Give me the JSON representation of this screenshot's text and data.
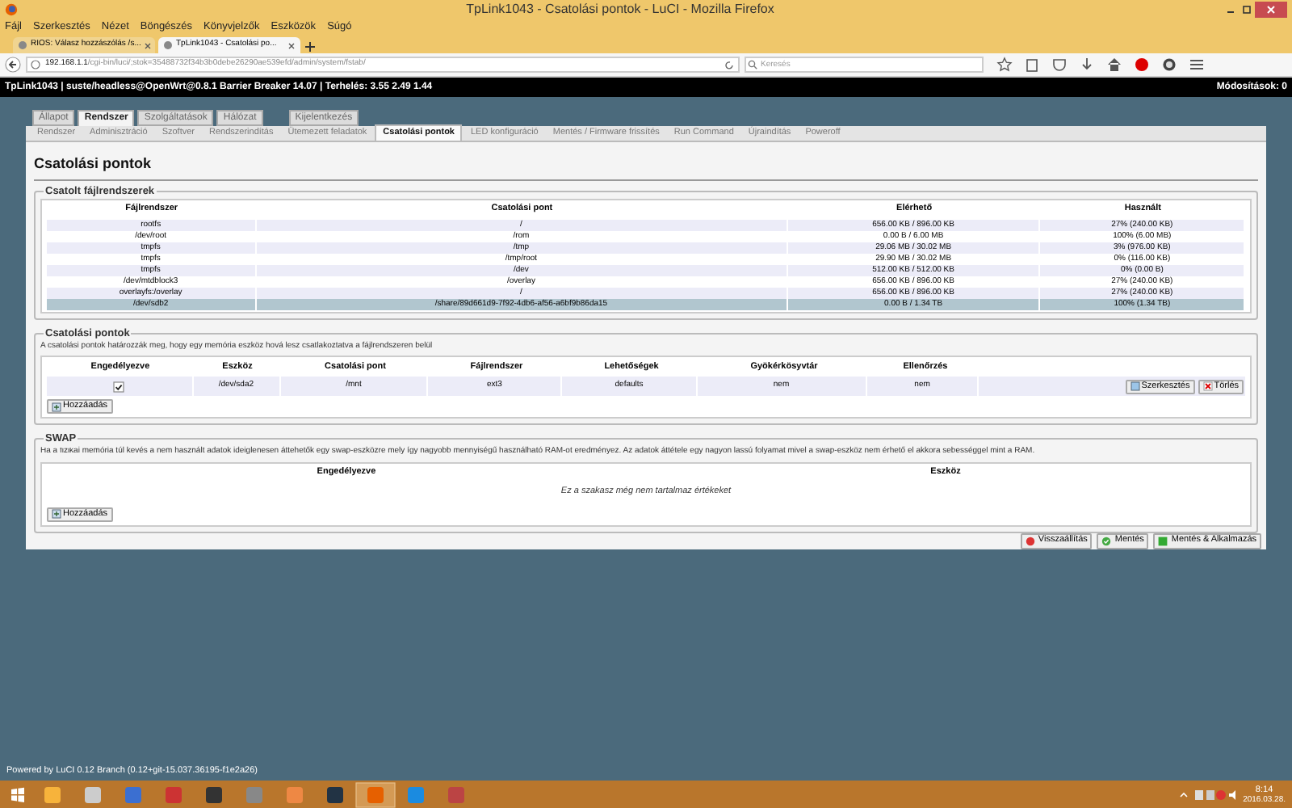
{
  "window": {
    "title": "TpLink1043 - Csatolási pontok - LuCI - Mozilla Firefox"
  },
  "menu": [
    "Fájl",
    "Szerkesztés",
    "Nézet",
    "Böngészés",
    "Könyvjelzők",
    "Eszközök",
    "Súgó"
  ],
  "browser_tabs": [
    {
      "label": "RIOS: Válasz hozzászólás /s...",
      "selected": false
    },
    {
      "label": "TpLink1043 - Csatolási po...",
      "selected": true
    }
  ],
  "address": {
    "host": "192.168.1.1",
    "path": "/cgi-bin/luci/;stok=35488732f34b3b0debe26290ae539efd/admin/system/fstab/"
  },
  "search": {
    "placeholder": "Keresés"
  },
  "status_bar": {
    "host_info": "TpLink1043 | suste/headless@OpenWrt@0.8.1 Barrier Breaker 14.07 | Terhelés: 3.55 2.49 1.44",
    "changes": "Módosítások: 0"
  },
  "main_tabs": [
    {
      "label": "Állapot",
      "selected": false
    },
    {
      "label": "Rendszer",
      "selected": true
    },
    {
      "label": "Szolgáltatások",
      "selected": false
    },
    {
      "label": "Hálózat",
      "selected": false
    },
    {
      "label": "Kijelentkezés",
      "selected": false
    }
  ],
  "sub_tabs": [
    {
      "label": "Rendszer",
      "selected": false
    },
    {
      "label": "Adminisztráció",
      "selected": false
    },
    {
      "label": "Szoftver",
      "selected": false
    },
    {
      "label": "Rendszerindítás",
      "selected": false
    },
    {
      "label": "Ütemezett feladatok",
      "selected": false
    },
    {
      "label": "Csatolási pontok",
      "selected": true
    },
    {
      "label": "LED konfiguráció",
      "selected": false
    },
    {
      "label": "Mentés / Firmware frissítés",
      "selected": false
    },
    {
      "label": "Run Command",
      "selected": false
    },
    {
      "label": "Újraindítás",
      "selected": false
    },
    {
      "label": "Poweroff",
      "selected": false
    }
  ],
  "page_title": "Csatolási pontok",
  "mounted": {
    "legend": "Csatolt fájlrendszerek",
    "columns": [
      "Fájlrendszer",
      "Csatolási pont",
      "Elérhető",
      "Használt"
    ],
    "rows": [
      {
        "cells": [
          "rootfs",
          "/",
          "656.00 KB / 896.00 KB",
          "27% (240.00 KB)"
        ],
        "highlighted": false
      },
      {
        "cells": [
          "/dev/root",
          "/rom",
          "0.00 B / 6.00 MB",
          "100% (6.00 MB)"
        ],
        "highlighted": false
      },
      {
        "cells": [
          "tmpfs",
          "/tmp",
          "29.06 MB / 30.02 MB",
          "3% (976.00 KB)"
        ],
        "highlighted": false
      },
      {
        "cells": [
          "tmpfs",
          "/tmp/root",
          "29.90 MB / 30.02 MB",
          "0% (116.00 KB)"
        ],
        "highlighted": false
      },
      {
        "cells": [
          "tmpfs",
          "/dev",
          "512.00 KB / 512.00 KB",
          "0% (0.00 B)"
        ],
        "highlighted": false
      },
      {
        "cells": [
          "/dev/mtdblock3",
          "/overlay",
          "656.00 KB / 896.00 KB",
          "27% (240.00 KB)"
        ],
        "highlighted": false
      },
      {
        "cells": [
          "overlayfs:/overlay",
          "/",
          "656.00 KB / 896.00 KB",
          "27% (240.00 KB)"
        ],
        "highlighted": false
      },
      {
        "cells": [
          "/dev/sdb2",
          "/share/89d661d9-7f92-4db6-af56-a6bf9b86da15",
          "0.00 B / 1.34 TB",
          "100% (1.34 TB)"
        ],
        "highlighted": true
      }
    ]
  },
  "mount_points": {
    "legend": "Csatolási pontok",
    "description": "A csatolási pontok határozzák meg, hogy egy memória eszköz hová lesz csatlakoztatva a fájlrendszeren belül",
    "columns": [
      "Engedélyezve",
      "Eszköz",
      "Csatolási pont",
      "Fájlrendszer",
      "Lehetőségek",
      "Gyökérkösyvtár",
      "Ellenőrzés"
    ],
    "rows": [
      {
        "enabled": true,
        "device": "/dev/sda2",
        "mount_point": "/mnt",
        "filesystem": "ext3",
        "options": "defaults",
        "root_fs": "nem",
        "check": "nem",
        "actions": [
          {
            "label": "Szerkesztés",
            "kind": "edit"
          },
          {
            "label": "Törlés",
            "kind": "delete"
          }
        ]
      }
    ],
    "add_button": "Hozzáadás"
  },
  "swap": {
    "legend": "SWAP",
    "description": "Ha a fizikai memória túl kevés a nem használt adatok ideiglenesen áttehetők egy swap-eszközre mely így nagyobb mennyiségű használható RAM-ot eredményez. Az adatok áttétele egy nagyon lassú folyamat mivel a swap-eszköz nem érhető el akkora sebességgel mint a RAM.",
    "columns": [
      "Engedélyezve",
      "Eszköz"
    ],
    "empty_text": "Ez a szakasz még nem tartalmaz értékeket",
    "add_button": "Hozzáadás"
  },
  "form_buttons": [
    {
      "label": "Visszaállítás",
      "kind": "reset"
    },
    {
      "label": "Mentés",
      "kind": "save"
    },
    {
      "label": "Mentés & Alkalmazás",
      "kind": "apply"
    }
  ],
  "footer": "Powered by LuCI 0.12 Branch (0.12+git-15.037.36195-f1e2a26)",
  "clock": {
    "time": "8:14",
    "date": "2016.03.28."
  }
}
